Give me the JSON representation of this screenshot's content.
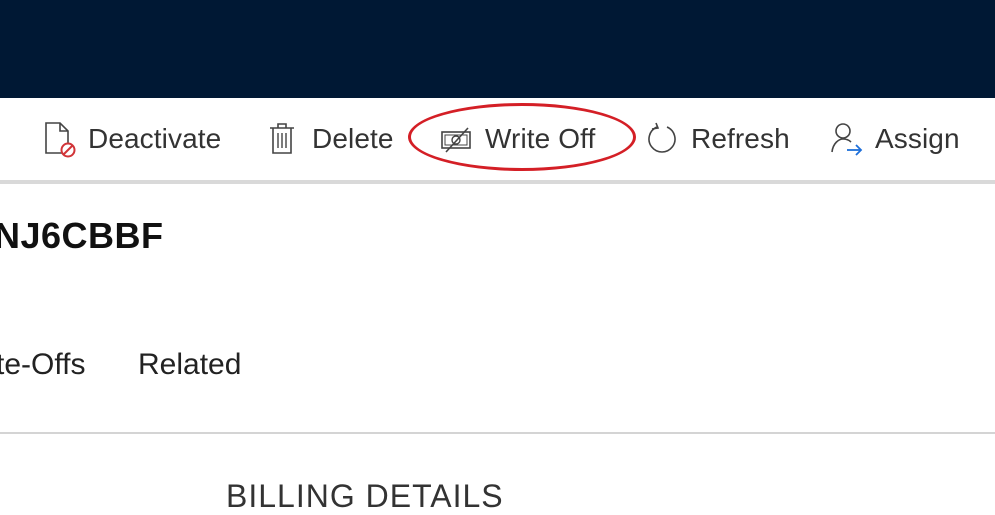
{
  "toolbar": {
    "commands": [
      {
        "label": "Deactivate",
        "icon": "deactivate-icon"
      },
      {
        "label": "Delete",
        "icon": "trash-icon"
      },
      {
        "label": "Write Off",
        "icon": "write-off-icon"
      },
      {
        "label": "Refresh",
        "icon": "refresh-icon"
      },
      {
        "label": "Assign",
        "icon": "assign-icon"
      }
    ]
  },
  "record": {
    "title": "NJ6CBBF"
  },
  "tabs": [
    {
      "label": "te-Offs"
    },
    {
      "label": "Related"
    }
  ],
  "sections": {
    "billing_heading": "BILLING DETAILS"
  },
  "colors": {
    "header_bg": "#001834",
    "highlight": "#d41f26",
    "assign_arrow": "#1e6fd9",
    "deactivate_badge": "#d13438"
  }
}
